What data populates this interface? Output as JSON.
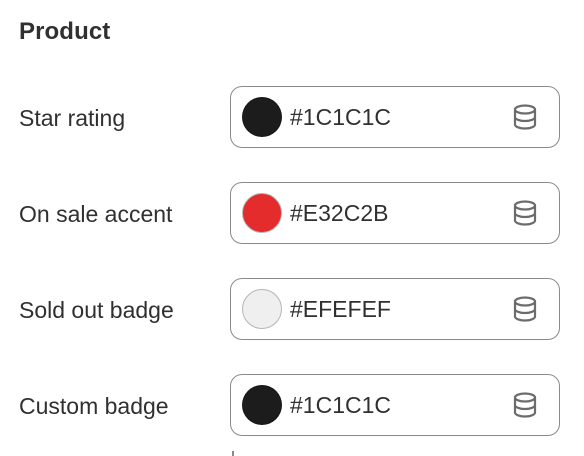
{
  "section": {
    "title": "Product"
  },
  "rows": [
    {
      "label": "Star rating",
      "value": "#1C1C1C",
      "swatch": "#1C1C1C",
      "icon": "database-icon"
    },
    {
      "label": "On sale accent",
      "value": "#E32C2B",
      "swatch": "#E32C2B",
      "icon": "database-icon"
    },
    {
      "label": "Sold out badge",
      "value": "#EFEFEF",
      "swatch": "#EFEFEF",
      "icon": "database-icon"
    },
    {
      "label": "Custom badge",
      "value": "#1C1C1C",
      "swatch": "#1C1C1C",
      "icon": "database-icon"
    }
  ]
}
